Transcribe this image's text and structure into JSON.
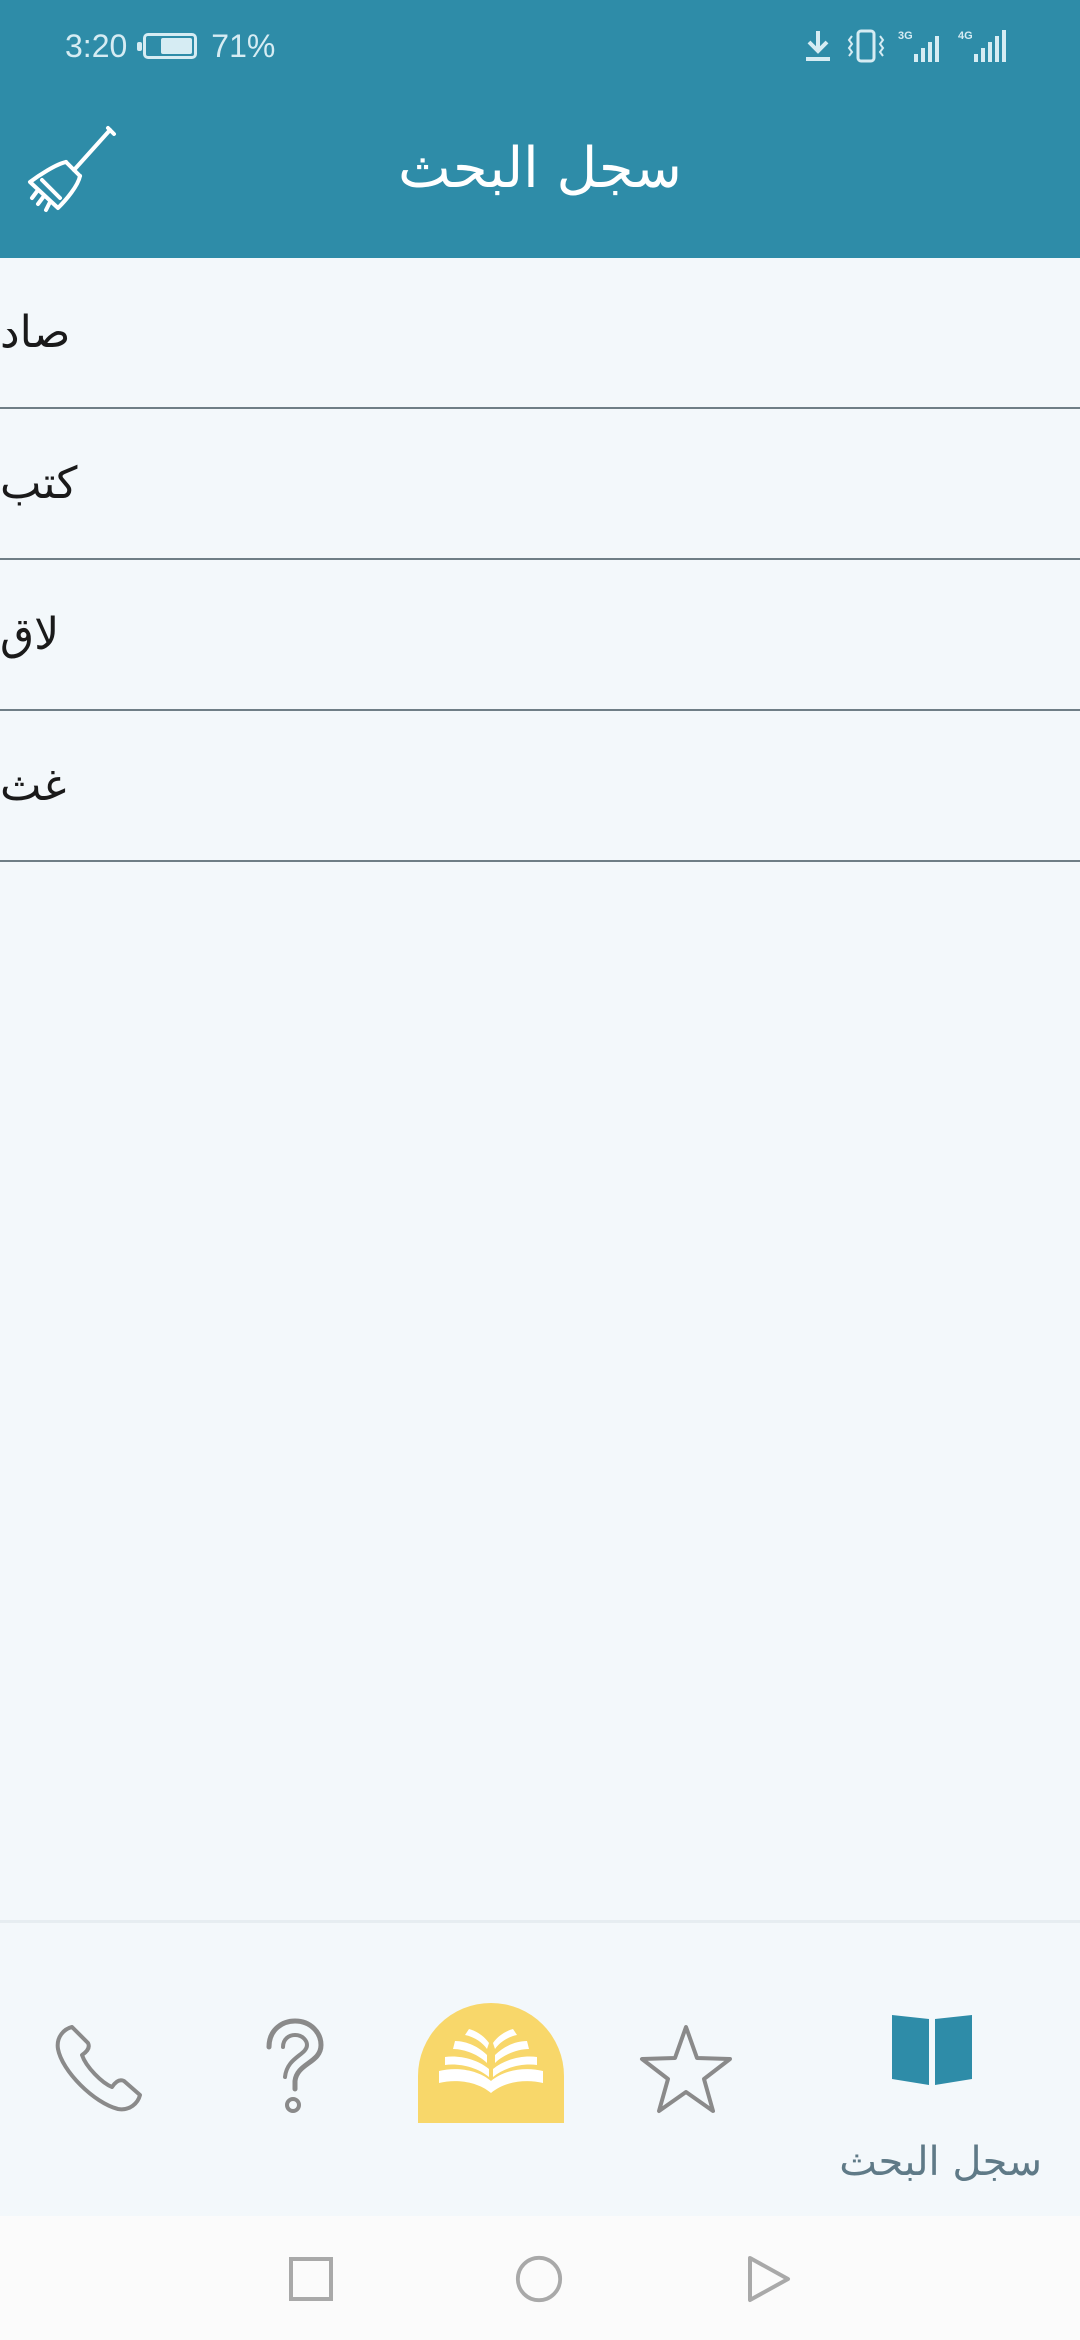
{
  "status_bar": {
    "time": "3:20",
    "battery_percent_text": "71%",
    "battery_level": 0.71,
    "network_labels": [
      "3G",
      "4G"
    ]
  },
  "app_bar": {
    "title": "سجل البحث",
    "clear_icon": "broom-icon"
  },
  "history": {
    "items": [
      "صاد",
      "كتب",
      "لاق",
      "غث"
    ]
  },
  "bottom_nav": {
    "items": [
      {
        "icon": "phone-icon"
      },
      {
        "icon": "question-icon"
      },
      {
        "icon": "book-open-icon"
      },
      {
        "icon": "star-icon"
      },
      {
        "icon": "book-icon",
        "label": "سجل البحث",
        "active": true
      }
    ]
  },
  "colors": {
    "primary": "#2e8ca8",
    "background": "#f3f8fb",
    "home_bubble": "#f8d76a",
    "nav_inactive": "#8a8a8a",
    "nav_active": "#2e8ca8"
  }
}
